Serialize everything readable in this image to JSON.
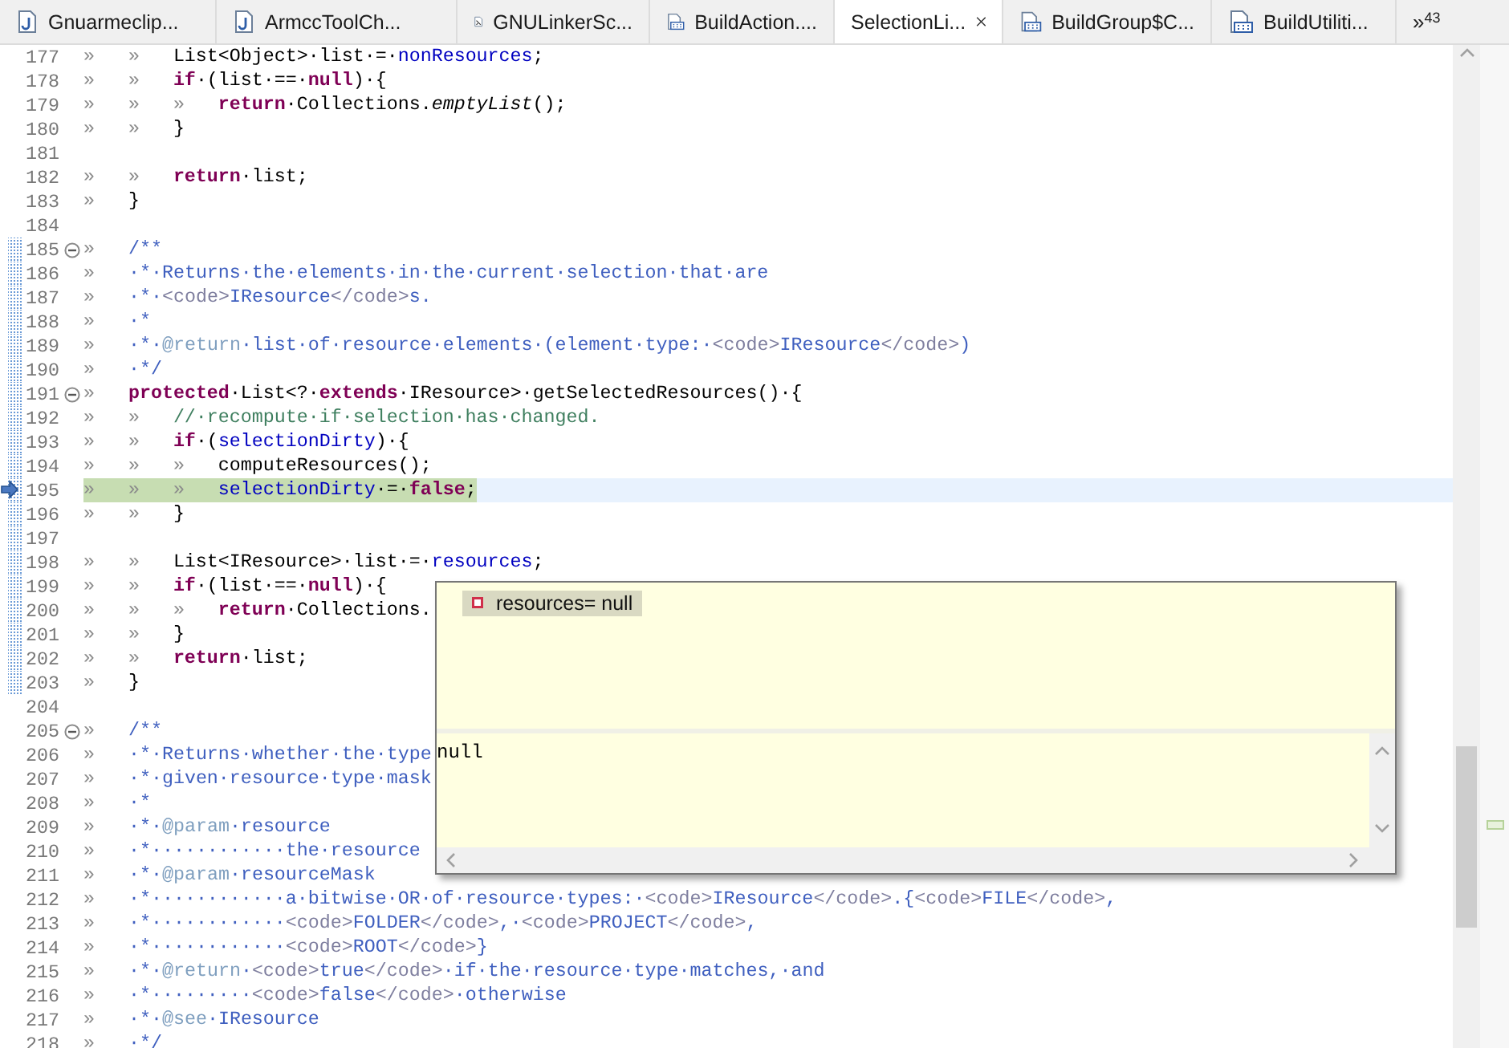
{
  "tabs": [
    {
      "label": "Gnuarmeclip...",
      "selected": false,
      "kind": "java"
    },
    {
      "label": "ArmccToolCh...",
      "selected": false,
      "kind": "java"
    },
    {
      "label": "GNULinkerSc...",
      "selected": false,
      "kind": "script"
    },
    {
      "label": "BuildAction....",
      "selected": false,
      "kind": "class"
    },
    {
      "label": "SelectionLi...",
      "selected": true
    },
    {
      "label": "BuildGroup$C...",
      "selected": false,
      "kind": "class"
    },
    {
      "label": "BuildUtiliti...",
      "selected": false,
      "kind": "class"
    }
  ],
  "tab_overflow": {
    "glyph": "»",
    "count": "43"
  },
  "lines": [
    {
      "n": "177",
      "fold": false,
      "range": false,
      "current": false,
      "tokens": [
        {
          "kind": "tab",
          "text": "»"
        },
        {
          "kind": "tab",
          "text": "»"
        },
        {
          "kind": "plain",
          "text": "List<Object>·list·=·"
        },
        {
          "kind": "field",
          "text": "nonResources"
        },
        {
          "kind": "plain",
          "text": ";"
        }
      ]
    },
    {
      "n": "178",
      "fold": false,
      "range": false,
      "current": false,
      "tokens": [
        {
          "kind": "tab",
          "text": "»"
        },
        {
          "kind": "tab",
          "text": "»"
        },
        {
          "kind": "keyword",
          "text": "if"
        },
        {
          "kind": "plain",
          "text": "·(list·==·"
        },
        {
          "kind": "keyword",
          "text": "null"
        },
        {
          "kind": "plain",
          "text": ")·{"
        }
      ]
    },
    {
      "n": "179",
      "fold": false,
      "range": false,
      "current": false,
      "tokens": [
        {
          "kind": "tab",
          "text": "»"
        },
        {
          "kind": "tab",
          "text": "»"
        },
        {
          "kind": "tab",
          "text": "»"
        },
        {
          "kind": "keyword",
          "text": "return"
        },
        {
          "kind": "plain",
          "text": "·Collections."
        },
        {
          "kind": "static",
          "text": "emptyList"
        },
        {
          "kind": "plain",
          "text": "();"
        }
      ]
    },
    {
      "n": "180",
      "fold": false,
      "range": false,
      "current": false,
      "tokens": [
        {
          "kind": "tab",
          "text": "»"
        },
        {
          "kind": "tab",
          "text": "»"
        },
        {
          "kind": "plain",
          "text": "}"
        }
      ]
    },
    {
      "n": "181",
      "fold": false,
      "range": false,
      "current": false
    },
    {
      "n": "182",
      "fold": false,
      "range": false,
      "current": false,
      "tokens": [
        {
          "kind": "tab",
          "text": "»"
        },
        {
          "kind": "tab",
          "text": "»"
        },
        {
          "kind": "keyword",
          "text": "return"
        },
        {
          "kind": "plain",
          "text": "·list;"
        }
      ]
    },
    {
      "n": "183",
      "fold": false,
      "range": false,
      "current": false,
      "tokens": [
        {
          "kind": "tab",
          "text": "»"
        },
        {
          "kind": "plain",
          "text": "}"
        }
      ]
    },
    {
      "n": "184",
      "fold": false,
      "range": false,
      "current": false
    },
    {
      "n": "185",
      "fold": true,
      "range": true,
      "current": false,
      "tokens": [
        {
          "kind": "tab",
          "text": "»"
        },
        {
          "kind": "doc",
          "text": "/**"
        }
      ]
    },
    {
      "n": "186",
      "fold": false,
      "range": true,
      "current": false,
      "tokens": [
        {
          "kind": "tab",
          "text": "»"
        },
        {
          "kind": "doc",
          "text": "·*·Returns·the·elements·in·the·current·selection·that·are"
        }
      ]
    },
    {
      "n": "187",
      "fold": false,
      "range": true,
      "current": false,
      "tokens": [
        {
          "kind": "tab",
          "text": "»"
        },
        {
          "kind": "doc",
          "text": "·*·"
        },
        {
          "kind": "html",
          "text": "<code>"
        },
        {
          "kind": "doc",
          "text": "IResource"
        },
        {
          "kind": "html",
          "text": "</code>"
        },
        {
          "kind": "doc",
          "text": "s."
        }
      ]
    },
    {
      "n": "188",
      "fold": false,
      "range": true,
      "current": false,
      "tokens": [
        {
          "kind": "tab",
          "text": "»"
        },
        {
          "kind": "doc",
          "text": "·*"
        }
      ]
    },
    {
      "n": "189",
      "fold": false,
      "range": true,
      "current": false,
      "tokens": [
        {
          "kind": "tab",
          "text": "»"
        },
        {
          "kind": "doc",
          "text": "·*·"
        },
        {
          "kind": "tag",
          "text": "@return"
        },
        {
          "kind": "doc",
          "text": "·list·of·resource·elements·(element·type:·"
        },
        {
          "kind": "html",
          "text": "<code>"
        },
        {
          "kind": "doc",
          "text": "IResource"
        },
        {
          "kind": "html",
          "text": "</code>"
        },
        {
          "kind": "doc",
          "text": ")"
        }
      ]
    },
    {
      "n": "190",
      "fold": false,
      "range": true,
      "current": false,
      "tokens": [
        {
          "kind": "tab",
          "text": "»"
        },
        {
          "kind": "doc",
          "text": "·*/"
        }
      ]
    },
    {
      "n": "191",
      "fold": true,
      "range": true,
      "current": false,
      "tokens": [
        {
          "kind": "tab",
          "text": "»"
        },
        {
          "kind": "keyword",
          "text": "protected"
        },
        {
          "kind": "plain",
          "text": "·List<?·"
        },
        {
          "kind": "keyword",
          "text": "extends"
        },
        {
          "kind": "plain",
          "text": "·IResource>·getSelectedResources()·{"
        }
      ]
    },
    {
      "n": "192",
      "fold": false,
      "range": true,
      "current": false,
      "tokens": [
        {
          "kind": "tab",
          "text": "»"
        },
        {
          "kind": "tab",
          "text": "»"
        },
        {
          "kind": "comment",
          "text": "//·recompute·if·selection·has·changed."
        }
      ]
    },
    {
      "n": "193",
      "fold": false,
      "range": true,
      "current": false,
      "tokens": [
        {
          "kind": "tab",
          "text": "»"
        },
        {
          "kind": "tab",
          "text": "»"
        },
        {
          "kind": "keyword",
          "text": "if"
        },
        {
          "kind": "plain",
          "text": "·("
        },
        {
          "kind": "field",
          "text": "selectionDirty"
        },
        {
          "kind": "plain",
          "text": ")·{"
        }
      ]
    },
    {
      "n": "194",
      "fold": false,
      "range": true,
      "current": false,
      "tokens": [
        {
          "kind": "tab",
          "text": "»"
        },
        {
          "kind": "tab",
          "text": "»"
        },
        {
          "kind": "tab",
          "text": "»"
        },
        {
          "kind": "plain",
          "text": "computeResources();"
        }
      ]
    },
    {
      "n": "195",
      "fold": false,
      "range": true,
      "current": true,
      "tokens": [
        {
          "kind": "tab",
          "text": "»"
        },
        {
          "kind": "tab",
          "text": "»"
        },
        {
          "kind": "tab",
          "text": "»"
        },
        {
          "kind": "field",
          "text": "selectionDirty"
        },
        {
          "kind": "plain",
          "text": "·=·"
        },
        {
          "kind": "keyword",
          "text": "false"
        },
        {
          "kind": "plain",
          "text": ";"
        }
      ]
    },
    {
      "n": "196",
      "fold": false,
      "range": true,
      "current": false,
      "tokens": [
        {
          "kind": "tab",
          "text": "»"
        },
        {
          "kind": "tab",
          "text": "»"
        },
        {
          "kind": "plain",
          "text": "}"
        }
      ]
    },
    {
      "n": "197",
      "fold": false,
      "range": true,
      "current": false
    },
    {
      "n": "198",
      "fold": false,
      "range": true,
      "current": false,
      "tokens": [
        {
          "kind": "tab",
          "text": "»"
        },
        {
          "kind": "tab",
          "text": "»"
        },
        {
          "kind": "plain",
          "text": "List<IResource>·list·=·"
        },
        {
          "kind": "field",
          "text": "resources"
        },
        {
          "kind": "plain",
          "text": ";"
        }
      ]
    },
    {
      "n": "199",
      "fold": false,
      "range": true,
      "current": false,
      "tokens": [
        {
          "kind": "tab",
          "text": "»"
        },
        {
          "kind": "tab",
          "text": "»"
        },
        {
          "kind": "keyword",
          "text": "if"
        },
        {
          "kind": "plain",
          "text": "·(list·==·"
        },
        {
          "kind": "keyword",
          "text": "null"
        },
        {
          "kind": "plain",
          "text": ")·{"
        }
      ]
    },
    {
      "n": "200",
      "fold": false,
      "range": true,
      "current": false,
      "tokens": [
        {
          "kind": "tab",
          "text": "»"
        },
        {
          "kind": "tab",
          "text": "»"
        },
        {
          "kind": "tab",
          "text": "»"
        },
        {
          "kind": "keyword",
          "text": "return"
        },
        {
          "kind": "plain",
          "text": "·Collections."
        }
      ]
    },
    {
      "n": "201",
      "fold": false,
      "range": true,
      "current": false,
      "tokens": [
        {
          "kind": "tab",
          "text": "»"
        },
        {
          "kind": "tab",
          "text": "»"
        },
        {
          "kind": "plain",
          "text": "}"
        }
      ]
    },
    {
      "n": "202",
      "fold": false,
      "range": true,
      "current": false,
      "tokens": [
        {
          "kind": "tab",
          "text": "»"
        },
        {
          "kind": "tab",
          "text": "»"
        },
        {
          "kind": "keyword",
          "text": "return"
        },
        {
          "kind": "plain",
          "text": "·list;"
        }
      ]
    },
    {
      "n": "203",
      "fold": false,
      "range": true,
      "current": false,
      "tokens": [
        {
          "kind": "tab",
          "text": "»"
        },
        {
          "kind": "plain",
          "text": "}"
        }
      ]
    },
    {
      "n": "204",
      "fold": false,
      "range": false,
      "current": false
    },
    {
      "n": "205",
      "fold": true,
      "range": false,
      "current": false,
      "tokens": [
        {
          "kind": "tab",
          "text": "»"
        },
        {
          "kind": "doc",
          "text": "/**"
        }
      ]
    },
    {
      "n": "206",
      "fold": false,
      "range": false,
      "current": false,
      "tokens": [
        {
          "kind": "tab",
          "text": "»"
        },
        {
          "kind": "doc",
          "text": "·*·Returns·whether·the·type"
        }
      ]
    },
    {
      "n": "207",
      "fold": false,
      "range": false,
      "current": false,
      "tokens": [
        {
          "kind": "tab",
          "text": "»"
        },
        {
          "kind": "doc",
          "text": "·*·given·resource·type·mask"
        }
      ]
    },
    {
      "n": "208",
      "fold": false,
      "range": false,
      "current": false,
      "tokens": [
        {
          "kind": "tab",
          "text": "»"
        },
        {
          "kind": "doc",
          "text": "·*"
        }
      ]
    },
    {
      "n": "209",
      "fold": false,
      "range": false,
      "current": false,
      "tokens": [
        {
          "kind": "tab",
          "text": "»"
        },
        {
          "kind": "doc",
          "text": "·*·"
        },
        {
          "kind": "tag",
          "text": "@param"
        },
        {
          "kind": "doc",
          "text": "·resource"
        }
      ]
    },
    {
      "n": "210",
      "fold": false,
      "range": false,
      "current": false,
      "tokens": [
        {
          "kind": "tab",
          "text": "»"
        },
        {
          "kind": "doc",
          "text": "·*············the·resource"
        }
      ]
    },
    {
      "n": "211",
      "fold": false,
      "range": false,
      "current": false,
      "tokens": [
        {
          "kind": "tab",
          "text": "»"
        },
        {
          "kind": "doc",
          "text": "·*·"
        },
        {
          "kind": "tag",
          "text": "@param"
        },
        {
          "kind": "doc",
          "text": "·resourceMask"
        }
      ]
    },
    {
      "n": "212",
      "fold": false,
      "range": false,
      "current": false,
      "tokens": [
        {
          "kind": "tab",
          "text": "»"
        },
        {
          "kind": "doc",
          "text": "·*············a·bitwise·OR·of·resource·types:·"
        },
        {
          "kind": "html",
          "text": "<code>"
        },
        {
          "kind": "doc",
          "text": "IResource"
        },
        {
          "kind": "html",
          "text": "</code>"
        },
        {
          "kind": "doc",
          "text": ".{"
        },
        {
          "kind": "html",
          "text": "<code>"
        },
        {
          "kind": "doc",
          "text": "FILE"
        },
        {
          "kind": "html",
          "text": "</code>"
        },
        {
          "kind": "doc",
          "text": ","
        }
      ]
    },
    {
      "n": "213",
      "fold": false,
      "range": false,
      "current": false,
      "tokens": [
        {
          "kind": "tab",
          "text": "»"
        },
        {
          "kind": "doc",
          "text": "·*············"
        },
        {
          "kind": "html",
          "text": "<code>"
        },
        {
          "kind": "doc",
          "text": "FOLDER"
        },
        {
          "kind": "html",
          "text": "</code>"
        },
        {
          "kind": "doc",
          "text": ",·"
        },
        {
          "kind": "html",
          "text": "<code>"
        },
        {
          "kind": "doc",
          "text": "PROJECT"
        },
        {
          "kind": "html",
          "text": "</code>"
        },
        {
          "kind": "doc",
          "text": ","
        }
      ]
    },
    {
      "n": "214",
      "fold": false,
      "range": false,
      "current": false,
      "tokens": [
        {
          "kind": "tab",
          "text": "»"
        },
        {
          "kind": "doc",
          "text": "·*············"
        },
        {
          "kind": "html",
          "text": "<code>"
        },
        {
          "kind": "doc",
          "text": "ROOT"
        },
        {
          "kind": "html",
          "text": "</code>"
        },
        {
          "kind": "doc",
          "text": "}"
        }
      ]
    },
    {
      "n": "215",
      "fold": false,
      "range": false,
      "current": false,
      "tokens": [
        {
          "kind": "tab",
          "text": "»"
        },
        {
          "kind": "doc",
          "text": "·*·"
        },
        {
          "kind": "tag",
          "text": "@return"
        },
        {
          "kind": "doc",
          "text": "·"
        },
        {
          "kind": "html",
          "text": "<code>"
        },
        {
          "kind": "doc",
          "text": "true"
        },
        {
          "kind": "html",
          "text": "</code>"
        },
        {
          "kind": "doc",
          "text": "·if·the·resource·type·matches,·and"
        }
      ]
    },
    {
      "n": "216",
      "fold": false,
      "range": false,
      "current": false,
      "tokens": [
        {
          "kind": "tab",
          "text": "»"
        },
        {
          "kind": "doc",
          "text": "·*·········"
        },
        {
          "kind": "html",
          "text": "<code>"
        },
        {
          "kind": "doc",
          "text": "false"
        },
        {
          "kind": "html",
          "text": "</code>"
        },
        {
          "kind": "doc",
          "text": "·otherwise"
        }
      ]
    },
    {
      "n": "217",
      "fold": false,
      "range": false,
      "current": false,
      "tokens": [
        {
          "kind": "tab",
          "text": "»"
        },
        {
          "kind": "doc",
          "text": "·*·"
        },
        {
          "kind": "tag",
          "text": "@see"
        },
        {
          "kind": "doc",
          "text": "·IResource"
        }
      ]
    },
    {
      "n": "218",
      "fold": false,
      "range": false,
      "current": false,
      "tokens": [
        {
          "kind": "tab",
          "text": "»"
        },
        {
          "kind": "doc",
          "text": "·*/"
        }
      ]
    }
  ],
  "hover": {
    "variable": {
      "label": "resources= null",
      "selected": true
    },
    "detail": "null"
  }
}
